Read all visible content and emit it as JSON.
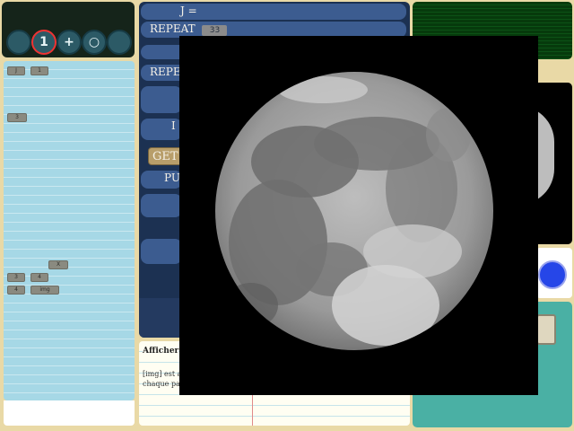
{
  "toolbar": {
    "buttons": [
      {
        "icon": "circle-icon",
        "glyph": ""
      },
      {
        "icon": "one-icon",
        "glyph": "1"
      },
      {
        "icon": "plus-icon",
        "glyph": "+"
      },
      {
        "icon": "ring-icon",
        "glyph": "○"
      },
      {
        "icon": "circle-icon",
        "glyph": ""
      }
    ]
  },
  "code_chips": [
    "J",
    "1",
    "3",
    "X",
    "3",
    "4",
    "4",
    "img"
  ],
  "blocks": {
    "assign_label": "J =",
    "repeat_label": "REPEAT",
    "repeat_value": "33",
    "repeat2_label": "REPE",
    "i_label": "I",
    "get_label": "GET",
    "pu_label": "PU"
  },
  "card": {
    "title": "Afficher",
    "line1": "[img] est a",
    "line2": "chaque pa"
  },
  "overlay": {
    "icon": "moon-image"
  },
  "colors": {
    "toolbar_bg": "#15241a",
    "code_pane": "#a6d8e6",
    "block_blue": "#3c5c90",
    "screen_green": "#063a0c",
    "dot_blue": "#2646e8",
    "teal": "#4ab0a4"
  }
}
